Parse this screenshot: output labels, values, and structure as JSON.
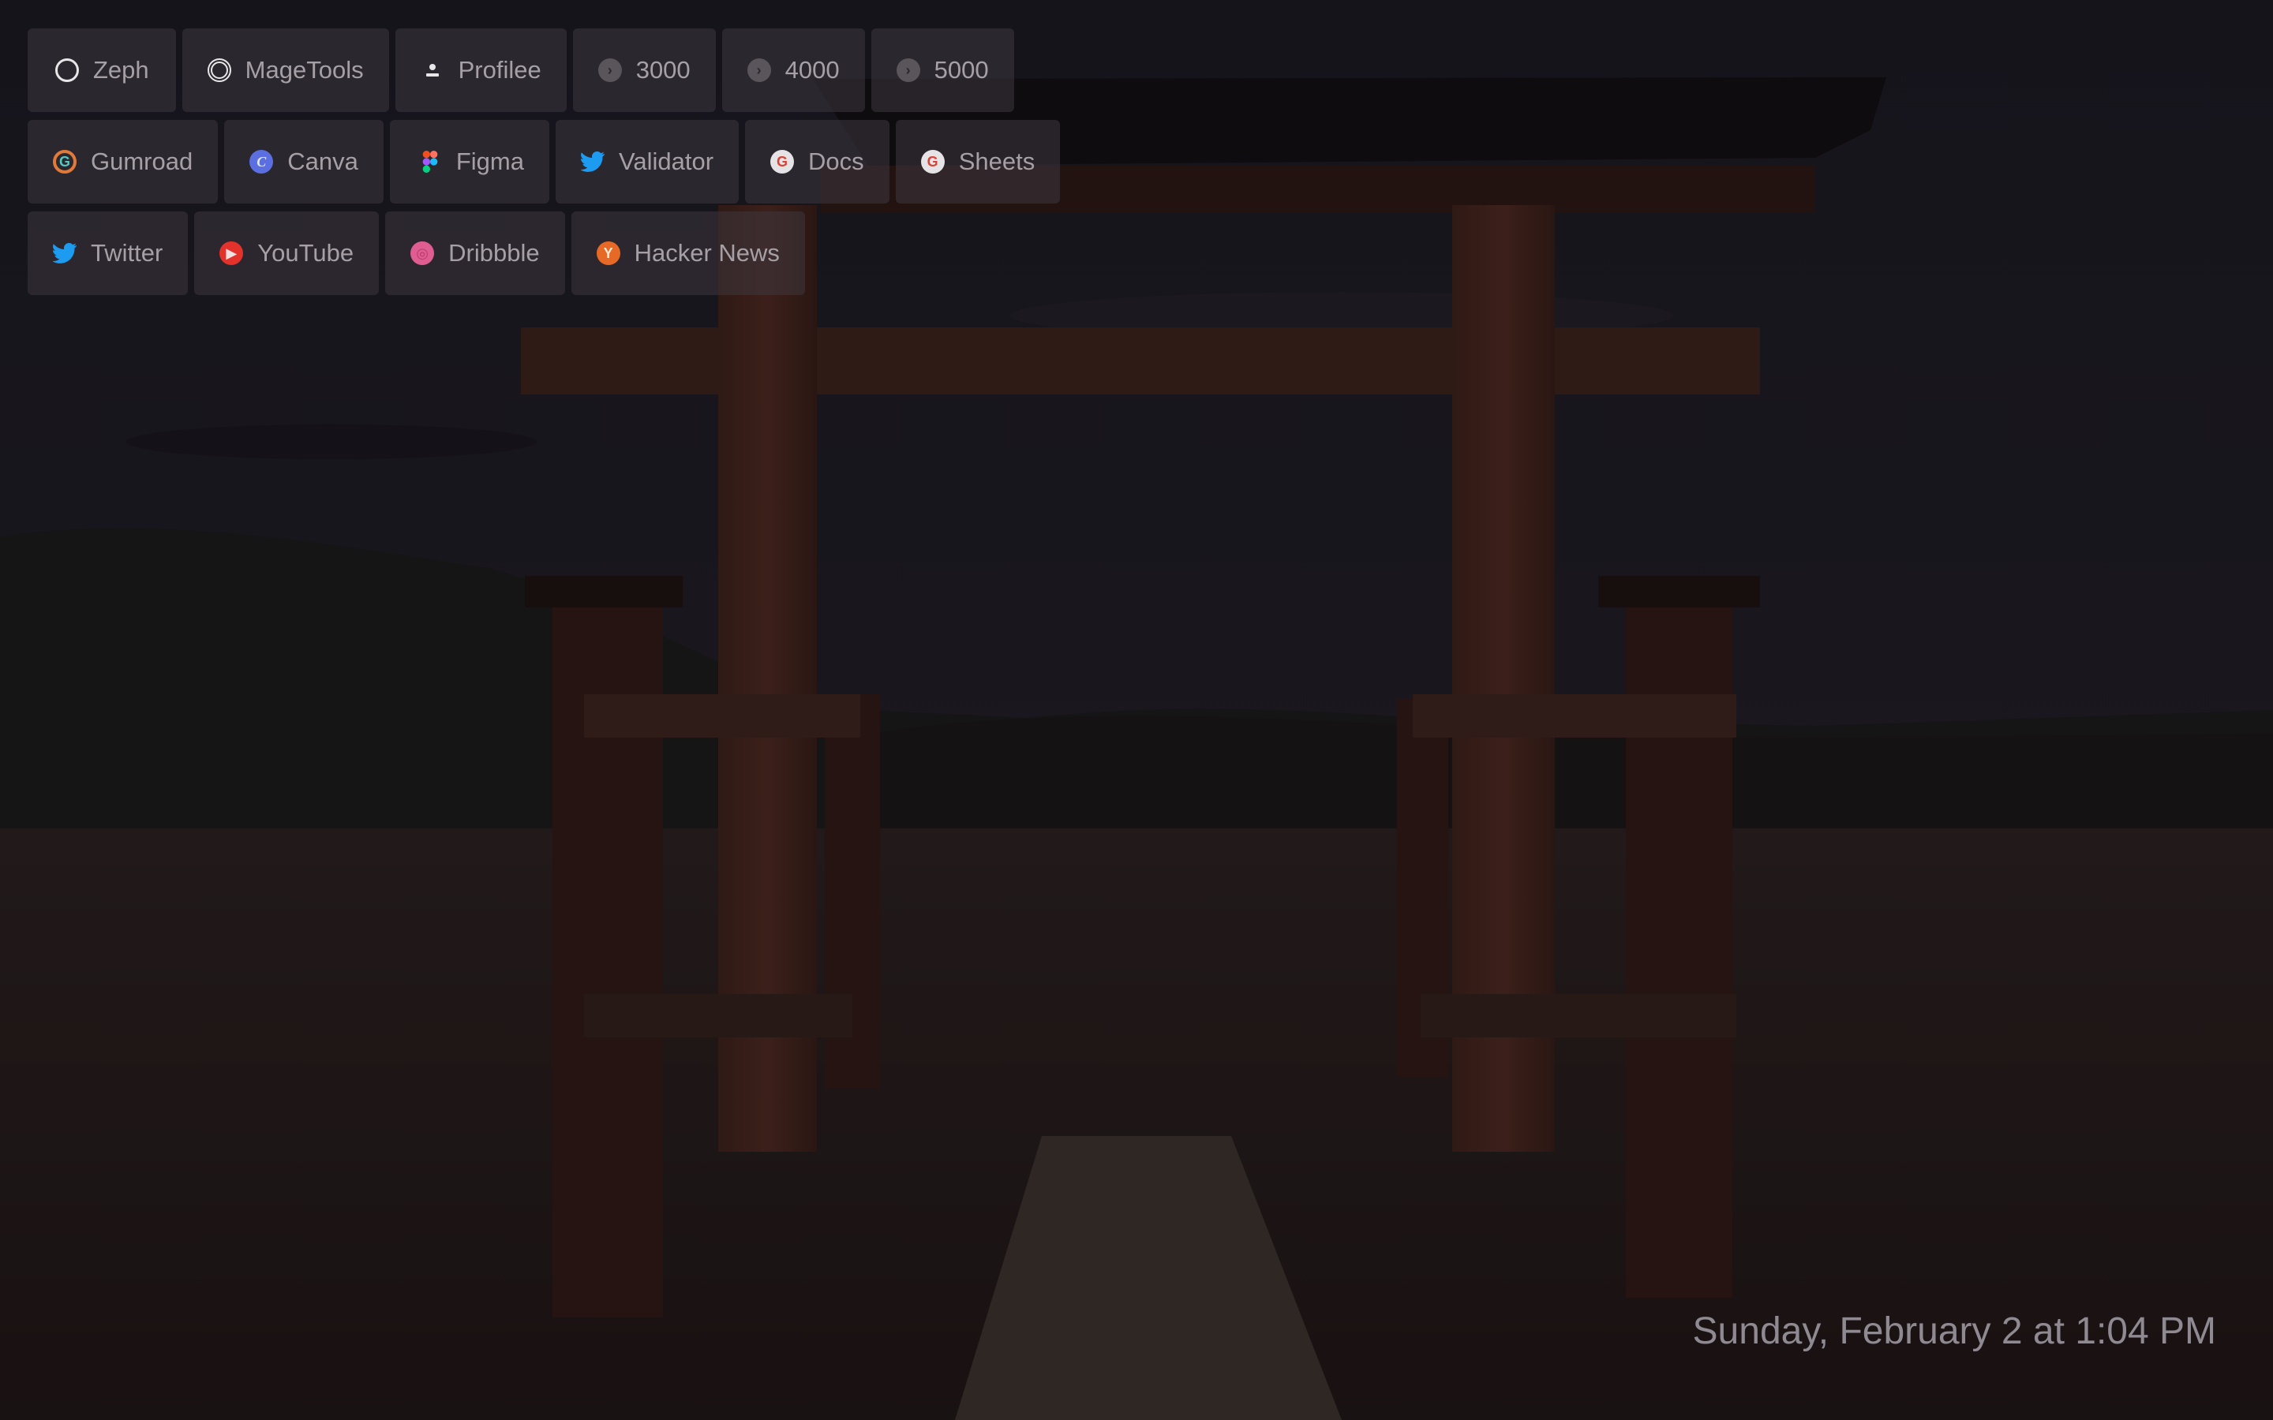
{
  "theme": {
    "chip_background": "#3e363e",
    "chip_text": "#a6a0a6",
    "clock_text": "#8f8a92"
  },
  "bookmarks": {
    "row1": [
      {
        "label": "Zeph",
        "icon": "circle-outline-icon"
      },
      {
        "label": "MageTools",
        "icon": "ring-icon"
      },
      {
        "label": "Profilee",
        "icon": "user-icon"
      },
      {
        "label": "3000",
        "icon": "arrow-right-circle-icon"
      },
      {
        "label": "4000",
        "icon": "arrow-right-circle-icon"
      },
      {
        "label": "5000",
        "icon": "arrow-right-circle-icon"
      }
    ],
    "row2": [
      {
        "label": "Gumroad",
        "icon": "gumroad-icon"
      },
      {
        "label": "Canva",
        "icon": "canva-icon"
      },
      {
        "label": "Figma",
        "icon": "figma-icon"
      },
      {
        "label": "Validator",
        "icon": "twitter-bird-icon"
      },
      {
        "label": "Docs",
        "icon": "google-icon"
      },
      {
        "label": "Sheets",
        "icon": "google-icon"
      }
    ],
    "row3": [
      {
        "label": "Twitter",
        "icon": "twitter-bird-icon"
      },
      {
        "label": "YouTube",
        "icon": "youtube-icon"
      },
      {
        "label": "Dribbble",
        "icon": "dribbble-icon"
      },
      {
        "label": "Hacker News",
        "icon": "hacker-news-icon"
      }
    ]
  },
  "clock": {
    "text": "Sunday, February 2 at 1:04 PM"
  }
}
